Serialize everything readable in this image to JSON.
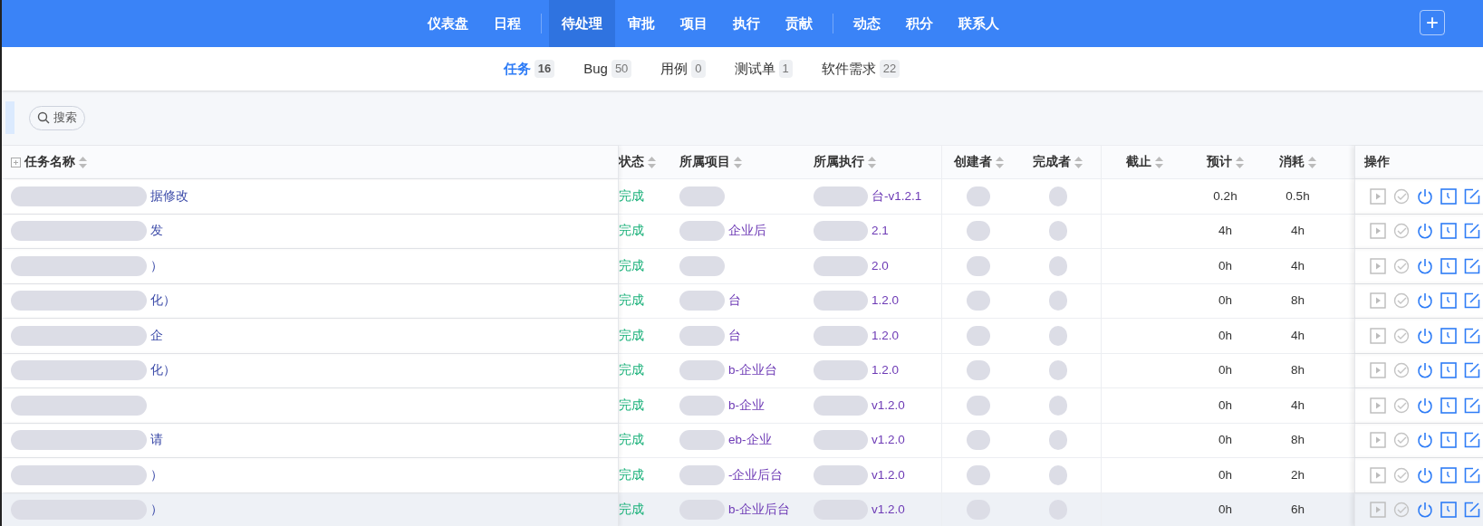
{
  "nav": {
    "groups": [
      [
        {
          "label": "仪表盘",
          "selected": false
        },
        {
          "label": "日程",
          "selected": false
        }
      ],
      [
        {
          "label": "待处理",
          "selected": true
        },
        {
          "label": "审批",
          "selected": false
        },
        {
          "label": "项目",
          "selected": false
        },
        {
          "label": "执行",
          "selected": false
        },
        {
          "label": "贡献",
          "selected": false
        }
      ],
      [
        {
          "label": "动态",
          "selected": false
        },
        {
          "label": "积分",
          "selected": false
        },
        {
          "label": "联系人",
          "selected": false
        }
      ]
    ],
    "add_button": "+"
  },
  "sub_tabs": [
    {
      "label": "任务",
      "count": "16",
      "selected": true
    },
    {
      "label": "Bug",
      "count": "50",
      "selected": false
    },
    {
      "label": "用例",
      "count": "0",
      "selected": false
    },
    {
      "label": "测试单",
      "count": "1",
      "selected": false
    },
    {
      "label": "软件需求",
      "count": "22",
      "selected": false
    }
  ],
  "search": {
    "label": "搜索"
  },
  "table": {
    "columns": [
      {
        "label": "任务名称",
        "sortable": true
      },
      {
        "label": "状态",
        "sortable": true
      },
      {
        "label": "所属项目",
        "sortable": true
      },
      {
        "label": "所属执行",
        "sortable": true
      },
      {
        "label": "创建者",
        "sortable": true
      },
      {
        "label": "完成者",
        "sortable": true
      },
      {
        "label": "截止",
        "sortable": true
      },
      {
        "label": "预计",
        "sortable": true
      },
      {
        "label": "消耗",
        "sortable": true
      },
      {
        "label": "操作",
        "sortable": false
      }
    ],
    "rows": [
      {
        "redacted": true,
        "name": "据修改",
        "status": "完成",
        "project": "",
        "execution": "台-v1.2.1",
        "estimate": "0.2h",
        "consumed": "0.5h",
        "highlighted": false
      },
      {
        "redacted": true,
        "name": "发",
        "status": "完成",
        "project": "企业后",
        "execution": "2.1",
        "estimate": "4h",
        "consumed": "4h",
        "highlighted": false
      },
      {
        "redacted": true,
        "name": "）",
        "status": "完成",
        "project": "",
        "execution": "2.0",
        "estimate": "0h",
        "consumed": "4h",
        "highlighted": false
      },
      {
        "redacted": true,
        "name": "化）",
        "status": "完成",
        "project": "台",
        "execution": "1.2.0",
        "estimate": "0h",
        "consumed": "8h",
        "highlighted": false
      },
      {
        "redacted": true,
        "name": "企",
        "status": "完成",
        "project": "台",
        "execution": "1.2.0",
        "estimate": "0h",
        "consumed": "4h",
        "highlighted": false
      },
      {
        "redacted": true,
        "name": "化）",
        "status": "完成",
        "project": "b-企业台",
        "execution": "1.2.0",
        "estimate": "0h",
        "consumed": "8h",
        "highlighted": false
      },
      {
        "redacted": true,
        "name": "",
        "status": "完成",
        "project": "b-企业",
        "execution": "v1.2.0",
        "estimate": "0h",
        "consumed": "4h",
        "highlighted": false
      },
      {
        "redacted": true,
        "name": "请",
        "status": "完成",
        "project": "eb-企业",
        "execution": "v1.2.0",
        "estimate": "0h",
        "consumed": "8h",
        "highlighted": false
      },
      {
        "redacted": true,
        "name": "）",
        "status": "完成",
        "project": "-企业后台",
        "execution": "v1.2.0",
        "estimate": "0h",
        "consumed": "2h",
        "highlighted": false
      },
      {
        "redacted": true,
        "name": "）",
        "status": "完成",
        "project": "b-企业后台",
        "execution": "v1.2.0",
        "estimate": "0h",
        "consumed": "6h",
        "highlighted": true
      }
    ]
  }
}
